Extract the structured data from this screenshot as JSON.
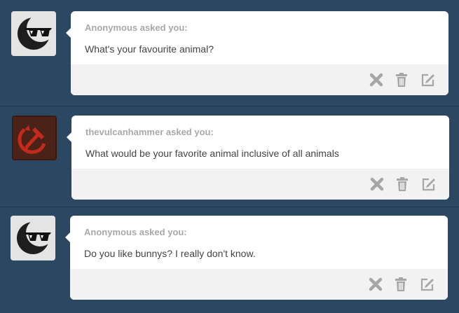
{
  "posts": [
    {
      "asker": "Anonymous asked you:",
      "question": "What's your favourite animal?",
      "avatar_icon": "sunglasses-moon-icon"
    },
    {
      "asker": "thevulcanhammer asked you:",
      "question": "What would be your favorite animal inclusive of all animals",
      "avatar_icon": "hammer-and-sickle-icon"
    },
    {
      "asker": "Anonymous asked you:",
      "question": "Do you like bunnys? I really don't know.",
      "avatar_icon": "sunglasses-moon-icon"
    }
  ],
  "actions": [
    "delete-icon",
    "trash-icon",
    "edit-icon"
  ],
  "colors": {
    "background": "#2c4762",
    "card": "#ffffff",
    "footer": "#f2f2f2",
    "asker_text": "#a8a8a8",
    "question_text": "#444444",
    "action_icon": "#a6a6a6"
  }
}
